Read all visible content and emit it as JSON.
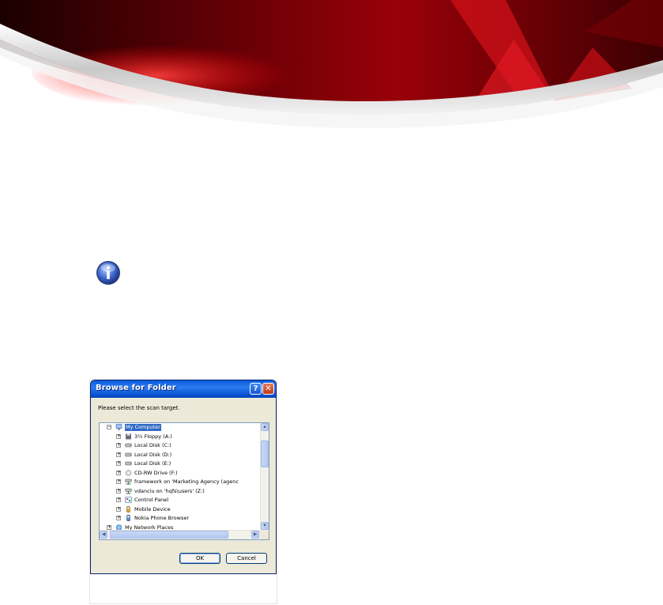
{
  "dialog": {
    "title": "Browse for Folder",
    "help_glyph": "?",
    "close_glyph": "✕",
    "prompt": "Please select the scan target.",
    "tree": [
      {
        "label": "My Computer",
        "icon": "computer-icon",
        "selected": true,
        "level": 0
      },
      {
        "label": "3½ Floppy (A:)",
        "icon": "floppy-icon",
        "level": 1
      },
      {
        "label": "Local Disk (C:)",
        "icon": "disk-icon",
        "level": 1
      },
      {
        "label": "Local Disk (D:)",
        "icon": "disk-icon",
        "level": 1
      },
      {
        "label": "Local Disk (E:)",
        "icon": "disk-icon",
        "level": 1
      },
      {
        "label": "CD-RW Drive (F:)",
        "icon": "cd-drive-icon",
        "level": 1
      },
      {
        "label": "framework on 'Marketing Agency (agenc",
        "icon": "network-drive-icon",
        "level": 1
      },
      {
        "label": "vdanciu on 'hqfs\\users' (Z:)",
        "icon": "network-drive-icon",
        "level": 1
      },
      {
        "label": "Control Panel",
        "icon": "control-panel-icon",
        "level": 1
      },
      {
        "label": "Mobile Device",
        "icon": "mobile-device-icon",
        "level": 1
      },
      {
        "label": "Nokia Phone Browser",
        "icon": "phone-browser-icon",
        "level": 1
      },
      {
        "label": "My Network Places",
        "icon": "network-places-icon",
        "level": 0
      }
    ],
    "ok_label": "OK",
    "cancel_label": "Cancel"
  },
  "colors": {
    "banner_red": "#b0060c",
    "titlebar_blue": "#0a5bdc",
    "selection_blue": "#316ac5",
    "dialog_bg": "#ece9d8"
  }
}
